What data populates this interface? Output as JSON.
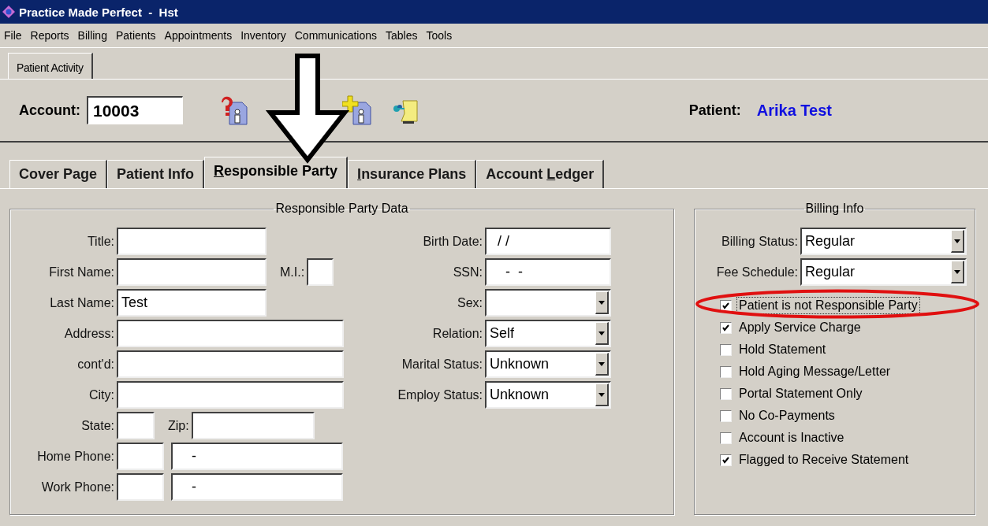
{
  "window": {
    "title": "Practice Made Perfect  -  Hst"
  },
  "menu": [
    "File",
    "Reports",
    "Billing",
    "Patients",
    "Appointments",
    "Inventory",
    "Communications",
    "Tables",
    "Tools"
  ],
  "top_tabs": [
    {
      "label": "Patient Activity",
      "selected": true
    }
  ],
  "account": {
    "label": "Account:",
    "value": "10003"
  },
  "patient": {
    "label": "Patient:",
    "name": "Arika Test"
  },
  "tabs": [
    {
      "pre": "Cover Page",
      "selected": false
    },
    {
      "pre": "Patient Info",
      "selected": false
    },
    {
      "key": "R",
      "post": "esponsible Party",
      "selected": true
    },
    {
      "key": "I",
      "post": "nsurance Plans",
      "selected": false
    },
    {
      "pre": "Account ",
      "key": "L",
      "post": "edger",
      "selected": false
    }
  ],
  "responsible_party": {
    "title": "Responsible Party Data",
    "left_rows": [
      {
        "label": "Title:",
        "fields": [
          {
            "kind": "medium"
          }
        ]
      },
      {
        "label": "First Name:",
        "fields": [
          {
            "kind": "medium"
          },
          {
            "label": "M.I.:",
            "kind": "tiny"
          }
        ]
      },
      {
        "label": "Last Name:",
        "fields": [
          {
            "kind": "medium",
            "value": "Test"
          }
        ]
      },
      {
        "label": "Address:",
        "fields": [
          {
            "kind": "long"
          }
        ]
      },
      {
        "label": "cont'd:",
        "fields": [
          {
            "kind": "long"
          }
        ]
      },
      {
        "label": "City:",
        "fields": [
          {
            "kind": "long"
          }
        ]
      },
      {
        "label": "State:",
        "fields": [
          {
            "kind": "small"
          },
          {
            "label": "Zip:",
            "kind": "zip"
          }
        ]
      },
      {
        "label": "Home Phone:",
        "fields": [
          {
            "kind": "area"
          },
          {
            "kind": "number",
            "value": "    -"
          }
        ]
      },
      {
        "label": "Work Phone:",
        "fields": [
          {
            "kind": "area"
          },
          {
            "kind": "number",
            "value": "    -"
          }
        ]
      }
    ],
    "right_rows": [
      {
        "label": "Birth Date:",
        "kind": "text",
        "value": "  / /"
      },
      {
        "label": "SSN:",
        "kind": "text",
        "value": "    -  -"
      },
      {
        "label": "Sex:",
        "kind": "dropdown"
      },
      {
        "label": "Relation:",
        "kind": "dropdown",
        "value": "Self"
      },
      {
        "label": "Marital Status:",
        "kind": "dropdown",
        "value": "Unknown"
      },
      {
        "label": "Employ Status:",
        "kind": "dropdown",
        "value": "Unknown"
      }
    ]
  },
  "billing_info": {
    "title": "Billing Info",
    "dropdowns": [
      {
        "label": "Billing Status:",
        "value": "Regular"
      },
      {
        "label": "Fee Schedule:",
        "value": "Regular"
      }
    ],
    "checkboxes": [
      {
        "label": "Patient is not Responsible Party",
        "checked": true,
        "focused": true
      },
      {
        "label": "Apply Service Charge",
        "checked": true,
        "focused": false
      },
      {
        "label": "Hold Statement",
        "checked": false,
        "focused": false
      },
      {
        "label": "Hold Aging Message/Letter",
        "checked": false,
        "focused": false
      },
      {
        "label": "Portal Statement Only",
        "checked": false,
        "focused": false
      },
      {
        "label": "No Co-Payments",
        "checked": false,
        "focused": false
      },
      {
        "label": "Account is Inactive",
        "checked": false,
        "focused": false
      },
      {
        "label": "Flagged to Receive Statement",
        "checked": true,
        "focused": false
      }
    ]
  }
}
